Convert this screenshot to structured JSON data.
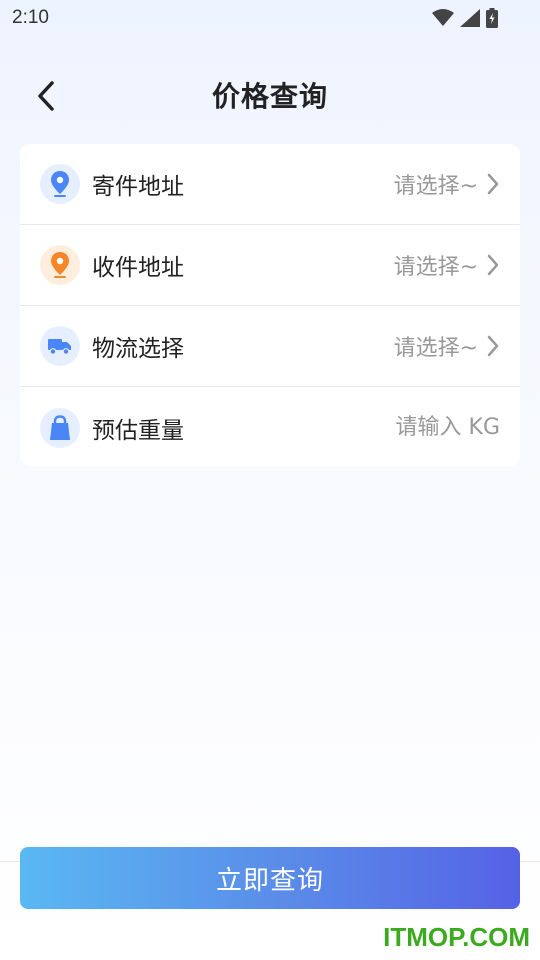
{
  "status_bar": {
    "time": "2:10",
    "icons": [
      "wifi-icon",
      "signal-icon",
      "battery-icon"
    ]
  },
  "header": {
    "title": "价格查询",
    "back_icon": "chevron-left-icon"
  },
  "form": {
    "rows": [
      {
        "label": "寄件地址",
        "value": "请选择~",
        "icon": "location-pin-icon",
        "icon_color": "#4a86f7"
      },
      {
        "label": "收件地址",
        "value": "请选择~",
        "icon": "location-pin-icon",
        "icon_color": "#f5862a"
      },
      {
        "label": "物流选择",
        "value": "请选择~",
        "icon": "truck-icon",
        "icon_color": "#4a86f7"
      },
      {
        "label": "预估重量",
        "placeholder": "请输入 KG",
        "icon": "bag-icon",
        "icon_color": "#4a86f7"
      }
    ]
  },
  "submit": {
    "label": "立即查询"
  },
  "watermark": "ITMOP.COM",
  "colors": {
    "accent_blue": "#4a86f7",
    "accent_orange": "#f5862a",
    "button_gradient_start": "#5ab8f3",
    "button_gradient_end": "#5562e6",
    "watermark_green": "#3caa1e"
  }
}
